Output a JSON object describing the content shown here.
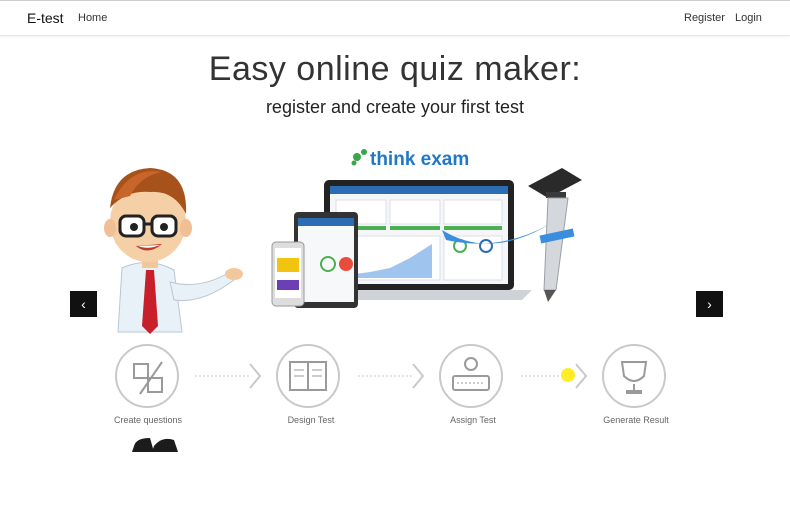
{
  "navbar": {
    "brand": "E-test",
    "home": "Home",
    "register": "Register",
    "login": "Login"
  },
  "hero": {
    "title": "Easy online quiz maker:",
    "subtitle": "register and create your first test"
  },
  "banner": {
    "logo_text": "think exam",
    "steps": [
      {
        "label": "Create questions",
        "icon": "create-questions-icon"
      },
      {
        "label": "Design Test",
        "icon": "book-icon"
      },
      {
        "label": "Assign Test",
        "icon": "keyboard-user-icon"
      },
      {
        "label": "Generate Result",
        "icon": "trophy-icon"
      }
    ]
  },
  "carousel": {
    "prev_glyph": "‹",
    "next_glyph": "›"
  },
  "colors": {
    "logo_blue": "#1f78c8",
    "logo_green": "#3aa64a",
    "control_bg": "#111111",
    "step_stroke": "#c9c9c9"
  }
}
